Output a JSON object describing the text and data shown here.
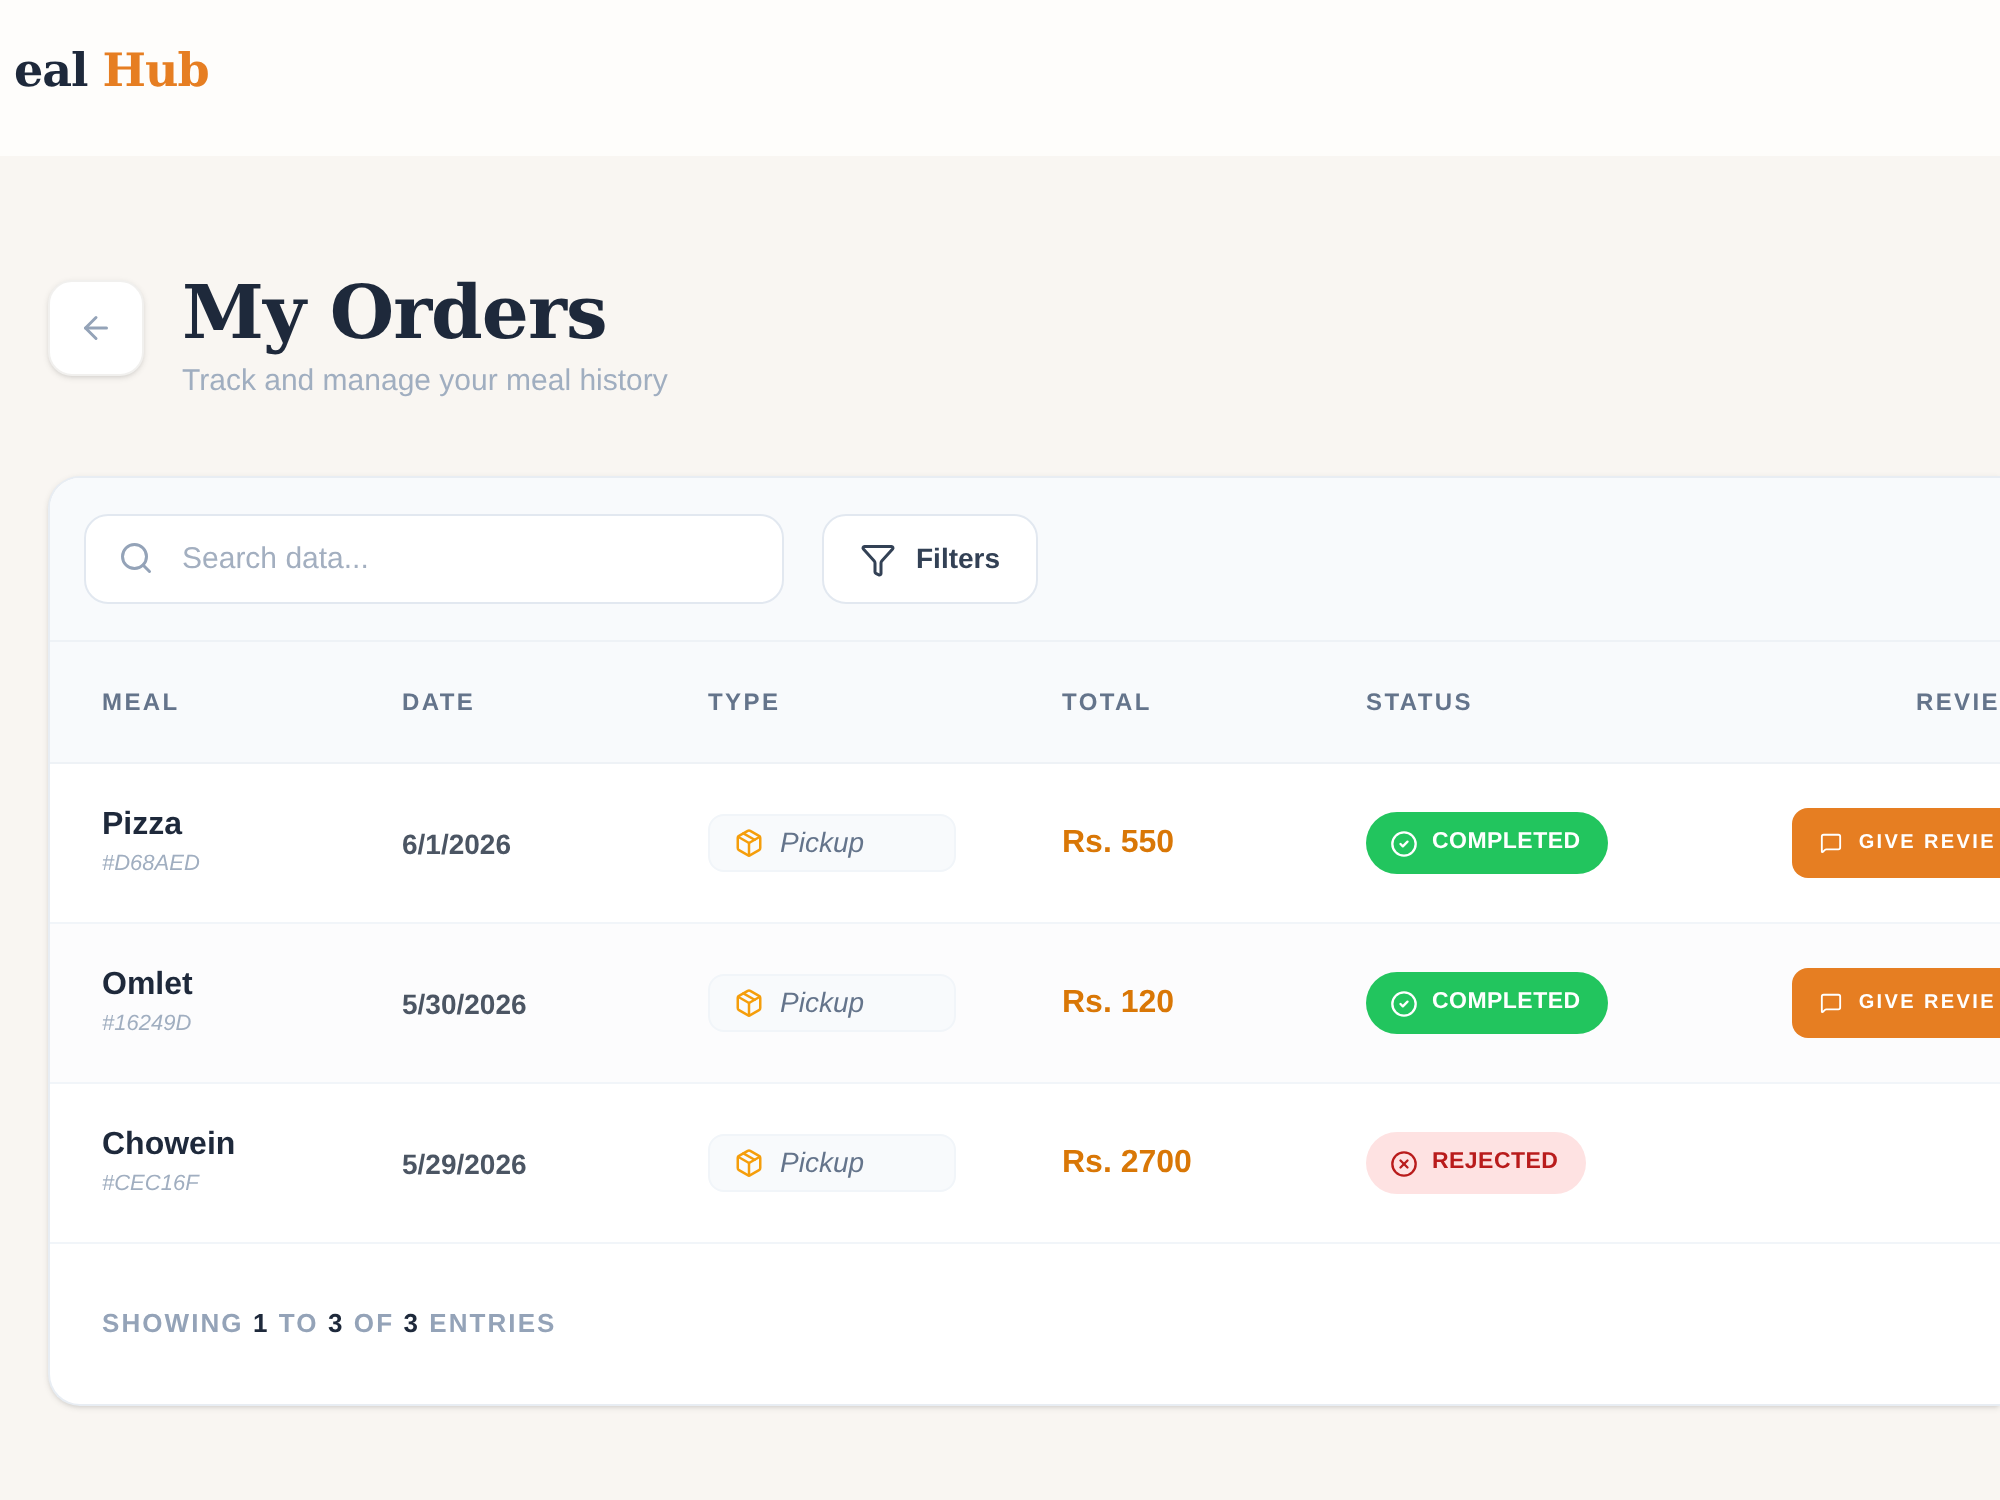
{
  "header": {
    "logo": {
      "text": "eal",
      "accent": "Hub"
    }
  },
  "page": {
    "title": "My Orders",
    "subtitle": "Track and manage your meal history"
  },
  "toolbar": {
    "search": {
      "placeholder": "Search data..."
    },
    "filters_button": "Filters"
  },
  "table": {
    "columns": [
      "MEAL",
      "DATE",
      "TYPE",
      "TOTAL",
      "STATUS",
      "REVIE"
    ],
    "rows": [
      {
        "meal": "Pizza",
        "order_id": "#D68AED",
        "date": "6/1/2026",
        "type": "Pickup",
        "total": "Rs. 550",
        "status": {
          "kind": "completed",
          "label": "COMPLETED"
        },
        "review_button": "GIVE REVIE"
      },
      {
        "meal": "Omlet",
        "order_id": "#16249D",
        "date": "5/30/2026",
        "type": "Pickup",
        "total": "Rs. 120",
        "status": {
          "kind": "completed",
          "label": "COMPLETED"
        },
        "review_button": "GIVE REVIE"
      },
      {
        "meal": "Chowein",
        "order_id": "#CEC16F",
        "date": "5/29/2026",
        "type": "Pickup",
        "total": "Rs. 2700",
        "status": {
          "kind": "rejected",
          "label": "REJECTED"
        }
      }
    ]
  },
  "footer": {
    "showing": "SHOWING **1** TO **3** OF **3** ENTRIES"
  }
}
